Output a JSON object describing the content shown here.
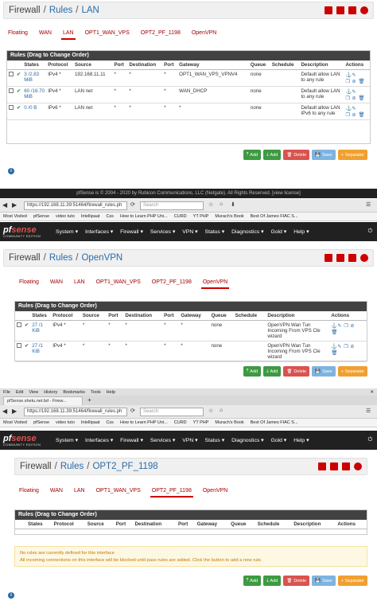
{
  "section1": {
    "breadcrumb": {
      "root": "Firewall",
      "mid": "Rules",
      "leaf": "LAN"
    },
    "tabs": [
      "Floating",
      "WAN",
      "LAN",
      "OPT1_WAN_VPS",
      "OPT2_PF_1198",
      "OpenVPN"
    ],
    "active_tab": 2,
    "rules_title": "Rules (Drag to Change Order)",
    "columns": [
      "States",
      "Protocol",
      "Source",
      "Port",
      "Destination",
      "Port",
      "Gateway",
      "Queue",
      "Schedule",
      "Description",
      "Actions"
    ],
    "rows": [
      {
        "states": "3 /2.83 MiB",
        "protocol": "IPv4 *",
        "source": "192.168.11.11",
        "port": "*",
        "destination": "*",
        "dport": "*",
        "gateway": "OPT1_WAN_VPS_VPNV4",
        "queue": "none",
        "schedule": "",
        "description": "Default allow LAN to any rule"
      },
      {
        "states": "60 /16.70 MiB",
        "protocol": "IPv4 *",
        "source": "LAN net",
        "port": "*",
        "destination": "*",
        "dport": "*",
        "gateway": "WAN_DHCP",
        "queue": "none",
        "schedule": "",
        "description": "Default allow LAN to any rule"
      },
      {
        "states": "0 /0 B",
        "protocol": "IPv6 *",
        "source": "LAN net",
        "port": "*",
        "destination": "*",
        "dport": "*",
        "gateway": "*",
        "queue": "none",
        "schedule": "",
        "description": "Default allow LAN IPv6 to any rule"
      }
    ]
  },
  "buttons": {
    "add": "Add",
    "add2": "Add",
    "delete": "Delete",
    "save": "Save",
    "separator": "Separator"
  },
  "footer": {
    "text": "pfSense is © 2004 - 2020 by Rubicon Communications, LLC (Netgate). All Rights Reserved. [view license]"
  },
  "browser1": {
    "url": "https://192.168.11.39:51464/firewall_rules.ph",
    "search_placeholder": "Search",
    "bookmarks": [
      "Most Visited",
      "pfSense",
      "video tuto",
      "Intellipaat",
      "Css",
      "How to Learn PHP Uni...",
      "CURD",
      "YT PHP",
      "Murach's Book",
      "Best Of James FIAC S..."
    ]
  },
  "navbar": {
    "logo_pf": "pf",
    "logo_sense": "sense",
    "logo_sub": "COMMUNITY EDITION",
    "items": [
      "System ▾",
      "Interfaces ▾",
      "Firewall ▾",
      "Services ▾",
      "VPN ▾",
      "Status ▾",
      "Diagnostics ▾",
      "Gold ▾",
      "Help ▾"
    ]
  },
  "section2": {
    "breadcrumb": {
      "root": "Firewall",
      "mid": "Rules",
      "leaf": "OpenVPN"
    },
    "tabs": [
      "Floating",
      "WAN",
      "LAN",
      "OPT1_WAN_VPS",
      "OPT2_PF_1198",
      "OpenVPN"
    ],
    "active_tab": 5,
    "rules_title": "Rules (Drag to Change Order)",
    "columns": [
      "States",
      "Protocol",
      "Source",
      "Port",
      "Destination",
      "Port",
      "Gateway",
      "Queue",
      "Schedule",
      "Description",
      "Actions"
    ],
    "rows": [
      {
        "states": "27 /1 KiB",
        "protocol": "IPv4 *",
        "source": "*",
        "port": "*",
        "destination": "*",
        "dport": "*",
        "gateway": "*",
        "queue": "none",
        "schedule": "",
        "description": "OpenVPN Wan Tun Incoming From VPS Cle wizard"
      },
      {
        "states": "27 /1 KiB",
        "protocol": "IPv4 *",
        "source": "*",
        "port": "*",
        "destination": "*",
        "dport": "*",
        "gateway": "*",
        "queue": "none",
        "schedule": "",
        "description": "OpenVPN Wan Tun Incoming From VPS Cle wizard"
      }
    ]
  },
  "browser2": {
    "menu": [
      "File",
      "Edit",
      "View",
      "History",
      "Bookmarks",
      "Tools",
      "Help"
    ],
    "tab_title": "pfSense.shetu.net.bd - Firew...",
    "url": "https://192.168.11.39:51464/firewall_rules.ph",
    "search_placeholder": "Search",
    "bookmarks": [
      "Most Visited",
      "pfSense",
      "video tuto",
      "Intellipaat",
      "Css",
      "How to Learn PHP Uni...",
      "CURD",
      "YT PHP",
      "Murach's Book",
      "Best Of James FIAC S..."
    ]
  },
  "section3": {
    "breadcrumb": {
      "root": "Firewall",
      "mid": "Rules",
      "leaf": "OPT2_PF_1198"
    },
    "tabs": [
      "Floating",
      "WAN",
      "LAN",
      "OPT1_WAN_VPS",
      "OPT2_PF_1198",
      "OpenVPN"
    ],
    "active_tab": 4,
    "rules_title": "Rules (Drag to Change Order)",
    "columns": [
      "States",
      "Protocol",
      "Source",
      "Port",
      "Destination",
      "Port",
      "Gateway",
      "Queue",
      "Schedule",
      "Description",
      "Actions"
    ],
    "notice_line1": "No rules are currently defined for this interface",
    "notice_line2": "All incoming connections on this interface will be blocked until pass rules are added. Click the button to add a new rule."
  },
  "colors": {
    "accent": "#c00000",
    "nav": "#212121",
    "green": "#3e9a41",
    "red": "#d9534f",
    "orange": "#f0a030",
    "link": "#2a6aa8"
  }
}
